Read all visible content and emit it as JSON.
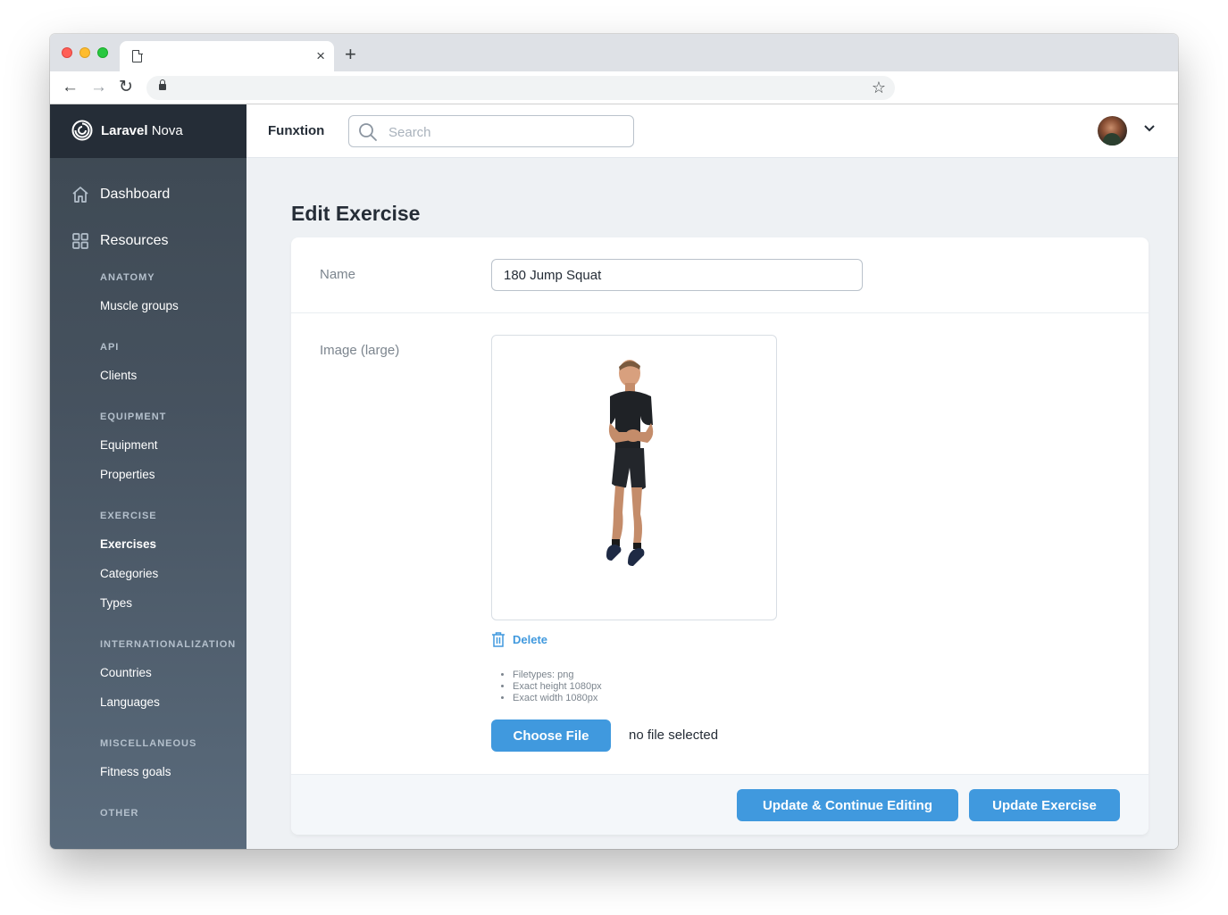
{
  "browser": {
    "tab_title": "",
    "tab_close": "×",
    "new_tab": "+",
    "back": "←",
    "forward": "→",
    "reload": "↻",
    "bookmark": "☆"
  },
  "brand": {
    "name_bold": "Laravel",
    "name_light": " Nova"
  },
  "sidebar": {
    "main": [
      {
        "label": "Dashboard",
        "icon": "home-icon"
      },
      {
        "label": "Resources",
        "icon": "grid-icon"
      }
    ],
    "sections": [
      {
        "title": "Anatomy",
        "items": [
          {
            "label": "Muscle groups",
            "active": false
          }
        ]
      },
      {
        "title": "Api",
        "items": [
          {
            "label": "Clients",
            "active": false
          }
        ]
      },
      {
        "title": "Equipment",
        "items": [
          {
            "label": "Equipment",
            "active": false
          },
          {
            "label": "Properties",
            "active": false
          }
        ]
      },
      {
        "title": "Exercise",
        "items": [
          {
            "label": "Exercises",
            "active": true
          },
          {
            "label": "Categories",
            "active": false
          },
          {
            "label": "Types",
            "active": false
          }
        ]
      },
      {
        "title": "Internationalization",
        "items": [
          {
            "label": "Countries",
            "active": false
          },
          {
            "label": "Languages",
            "active": false
          }
        ]
      },
      {
        "title": "Miscellaneous",
        "items": [
          {
            "label": "Fitness goals",
            "active": false
          }
        ]
      },
      {
        "title": "Other",
        "items": []
      }
    ]
  },
  "header": {
    "app_name": "Funxtion",
    "search_placeholder": "Search",
    "menu_chevron": "⌄"
  },
  "main": {
    "title": "Edit Exercise",
    "name_label": "Name",
    "name_value": "180 Jump Squat",
    "image_label": "Image (large)",
    "delete_label": "Delete",
    "rules": [
      "Filetypes: png",
      "Exact height 1080px",
      "Exact width 1080px"
    ],
    "choose_file": "Choose File",
    "no_file": "no file selected",
    "btn_continue": "Update & Continue Editing",
    "btn_update": "Update Exercise"
  },
  "colors": {
    "accent": "#4099de",
    "sidebar_top": "#3d4852",
    "brand_bg": "#252d37",
    "page_bg": "#eef1f4"
  }
}
